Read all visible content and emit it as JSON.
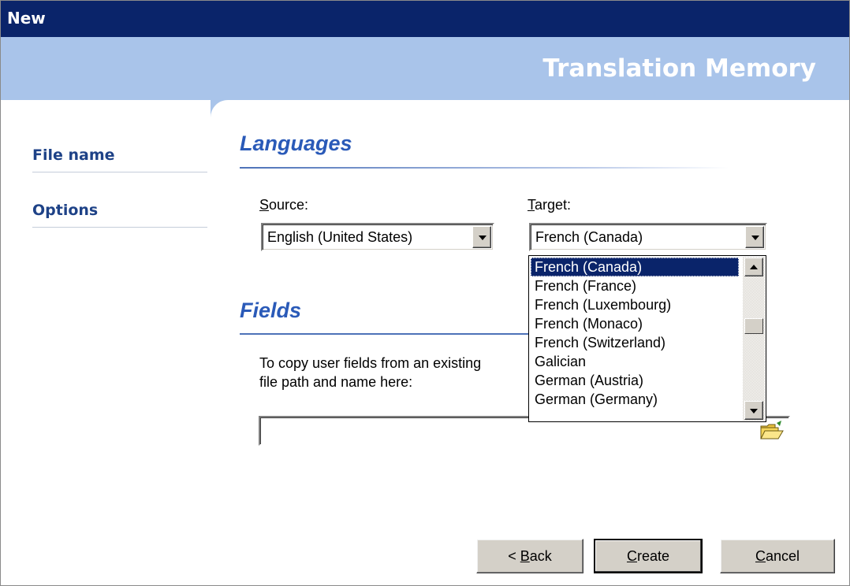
{
  "window": {
    "title": "New"
  },
  "banner": {
    "heading": "Translation Memory"
  },
  "sidebar": {
    "items": [
      {
        "label": "File name"
      },
      {
        "label": "Options"
      }
    ]
  },
  "languages": {
    "section_title": "Languages",
    "source": {
      "label_mnemonic": "S",
      "label_rest": "ource:",
      "value": "English (United States)"
    },
    "target": {
      "label_mnemonic": "T",
      "label_rest": "arget:",
      "value": "French (Canada)",
      "options": [
        "French (Canada)",
        "French (France)",
        "French (Luxembourg)",
        "French (Monaco)",
        "French (Switzerland)",
        "Galician",
        "German (Austria)",
        "German (Germany)"
      ],
      "selected_index": 0
    }
  },
  "fields": {
    "section_title": "Fields",
    "description_line1": "To copy user fields from an existing",
    "description_line2": "file path and name here:",
    "path_value": ""
  },
  "buttons": {
    "back": {
      "prefix": "< ",
      "mnemonic": "B",
      "rest": "ack"
    },
    "create": {
      "mnemonic": "C",
      "rest": "reate"
    },
    "cancel": {
      "mnemonic": "C",
      "rest": "ancel"
    }
  },
  "colors": {
    "title_bar": "#0a246a",
    "banner": "#a9c4ea",
    "nav_text": "#1e4287",
    "section_title": "#2a5ab8",
    "selection": "#0a246a"
  },
  "icons": {
    "browse": "folder-open-icon",
    "dropdown": "chevron-down-icon"
  }
}
